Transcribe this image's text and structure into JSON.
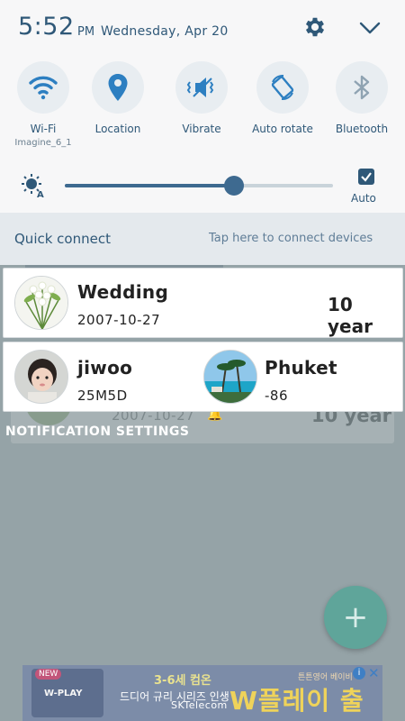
{
  "status": {
    "time": "5:52",
    "ampm": "PM",
    "date": "Wednesday, Apr 20"
  },
  "quick_settings": [
    {
      "label": "Wi-Fi",
      "sub": "Imagine_6_1",
      "icon": "wifi-icon",
      "active": true
    },
    {
      "label": "Location",
      "sub": "",
      "icon": "location-icon",
      "active": true
    },
    {
      "label": "Vibrate",
      "sub": "",
      "icon": "vibrate-icon",
      "active": true
    },
    {
      "label": "Auto rotate",
      "sub": "",
      "icon": "auto-rotate-icon",
      "active": true
    },
    {
      "label": "Bluetooth",
      "sub": "",
      "icon": "bluetooth-icon",
      "active": false
    }
  ],
  "brightness": {
    "level": 0.63,
    "auto_label": "Auto",
    "auto_checked": true
  },
  "quick_connect": {
    "title": "Quick connect",
    "hint": "Tap here to connect devices"
  },
  "cards": {
    "wedding": {
      "title": "Wedding",
      "date": "2007-10-27",
      "duration": "10 year"
    },
    "jiwoo": {
      "title": "jiwoo",
      "value": "25M5D"
    },
    "phuket": {
      "title": "Phuket",
      "value": "-86"
    }
  },
  "background": {
    "date": "2007-10-27",
    "year": "10 year"
  },
  "notification_settings": "NOTIFICATION SETTINGS",
  "ad": {
    "badge": "NEW",
    "brand": "W-PLAY",
    "line1": "3-6세 컴온",
    "line2": "드디어 규리 시리즈 인생",
    "big": "W플레이 출시",
    "small": "튼튼영어 베이비"
  },
  "carrier": "SKTelecom",
  "colors": {
    "accent": "#2f5878",
    "fab": "#5fa59a",
    "shade": "#f7f7f8"
  }
}
